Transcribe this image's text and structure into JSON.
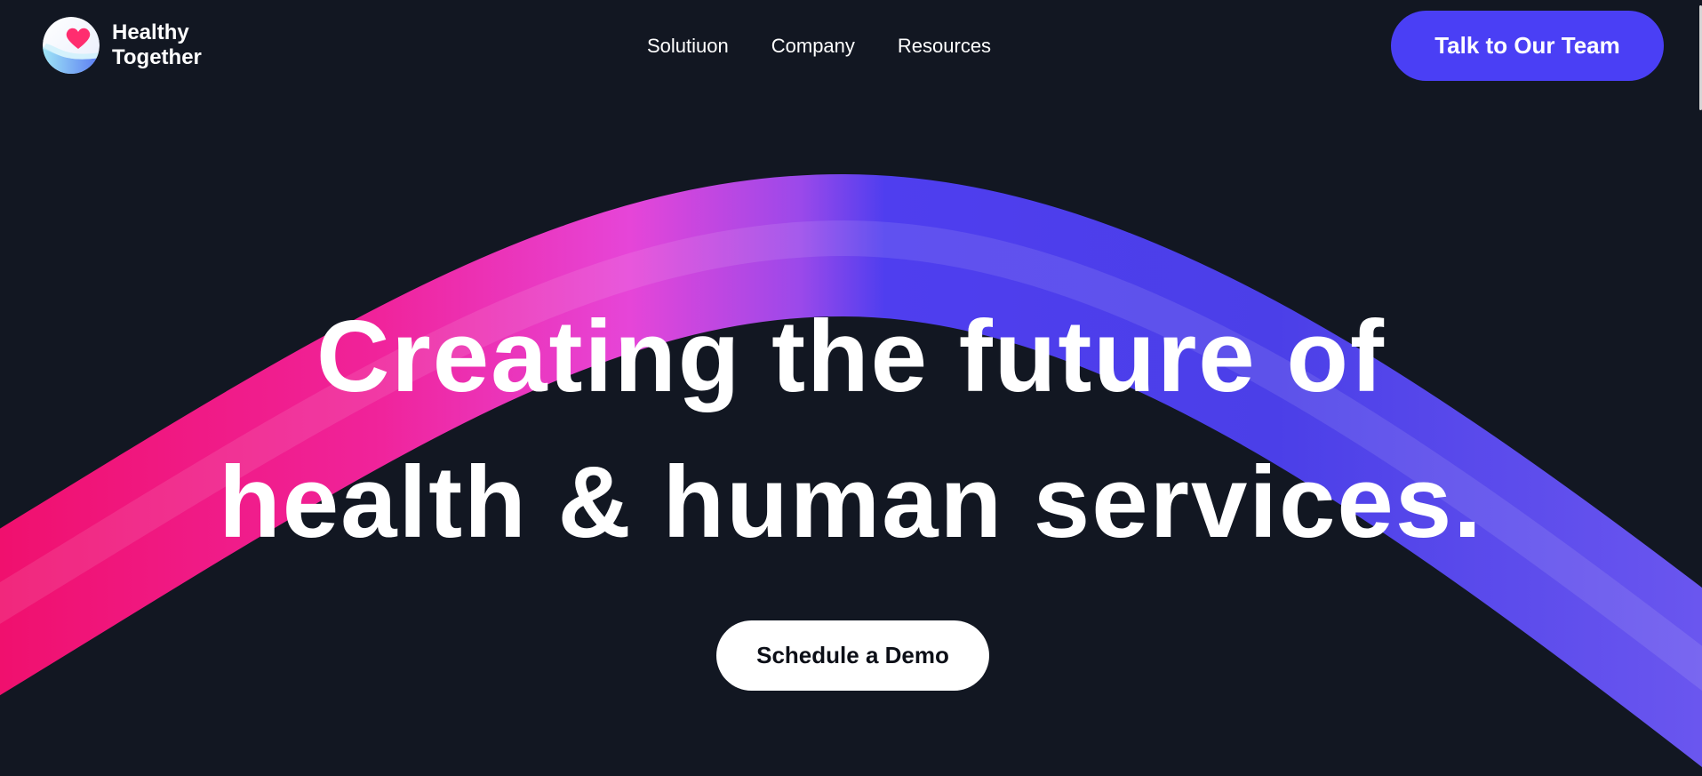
{
  "brand": {
    "name_line1": "Healthy",
    "name_line2": "Together",
    "logo_icon": "heart-icon",
    "accent_color": "#ff2d6f"
  },
  "nav": {
    "items": [
      {
        "label": "Solutiuon"
      },
      {
        "label": "Company"
      },
      {
        "label": "Resources"
      }
    ]
  },
  "header": {
    "cta_label": "Talk to Our Team",
    "cta_color": "#4a3ff5"
  },
  "hero": {
    "headline_line1": "Creating the future of",
    "headline_line2": "health & human services.",
    "cta_label": "Schedule a Demo",
    "background_color": "#121722",
    "arc_colors": [
      "#f0106e",
      "#e93ed6",
      "#4b3ef0",
      "#6b55ee"
    ]
  }
}
